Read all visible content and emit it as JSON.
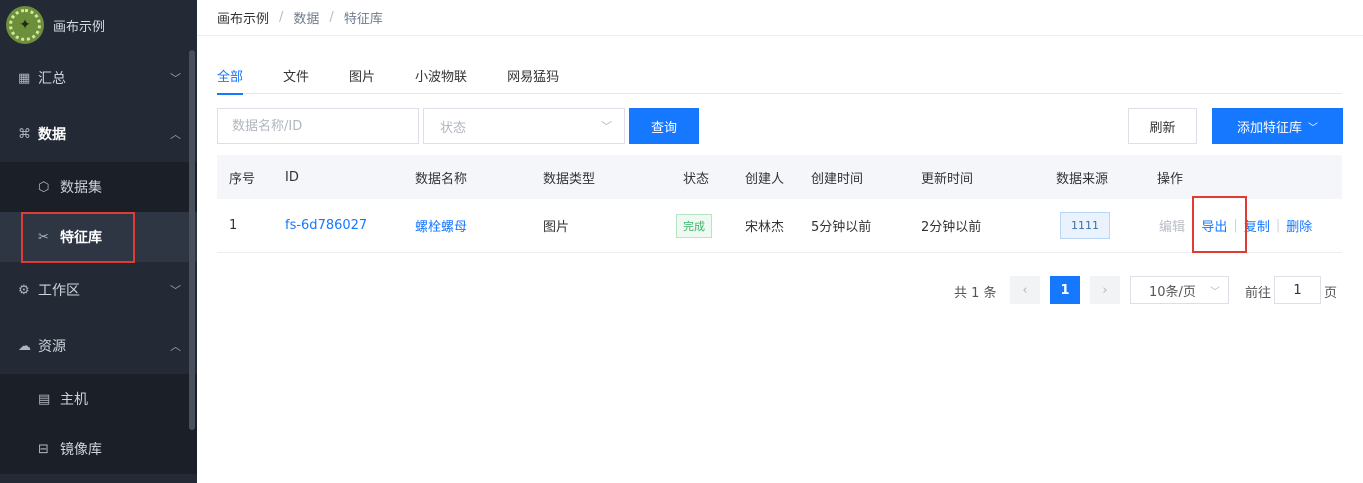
{
  "app": {
    "name": "画布示例"
  },
  "sidebar": {
    "groups": [
      {
        "label": "汇总",
        "icon": "grid-icon",
        "expanded": false
      },
      {
        "label": "数据",
        "icon": "hierarchy-icon",
        "expanded": true
      },
      {
        "label": "工作区",
        "icon": "gear-icon",
        "expanded": false
      },
      {
        "label": "资源",
        "icon": "cloud-icon",
        "expanded": true
      }
    ],
    "data_items": [
      {
        "label": "数据集",
        "icon": "cube-icon"
      },
      {
        "label": "特征库",
        "icon": "scissors-icon",
        "active": true
      }
    ],
    "resource_items": [
      {
        "label": "主机",
        "icon": "server-icon"
      },
      {
        "label": "镜像库",
        "icon": "storage-icon"
      }
    ]
  },
  "breadcrumb": [
    "画布示例",
    "数据",
    "特征库"
  ],
  "tabs": [
    "全部",
    "文件",
    "图片",
    "小波物联",
    "网易猛犸"
  ],
  "filters": {
    "search_placeholder": "数据名称/ID",
    "status_placeholder": "状态",
    "query_label": "查询",
    "refresh_label": "刷新",
    "add_label": "添加特征库"
  },
  "table": {
    "headers": [
      "序号",
      "ID",
      "数据名称",
      "数据类型",
      "状态",
      "创建人",
      "创建时间",
      "更新时间",
      "数据来源",
      "操作"
    ],
    "rows": [
      {
        "index": "1",
        "id": "fs-6d786027",
        "name": "螺栓螺母",
        "type": "图片",
        "status": "完成",
        "creator": "宋林杰",
        "created": "5分钟以前",
        "updated": "2分钟以前",
        "source": "1111",
        "ops": {
          "edit": "编辑",
          "export": "导出",
          "copy": "复制",
          "delete": "删除"
        }
      }
    ]
  },
  "pagination": {
    "total": "共 1 条",
    "current": "1",
    "page_size": "10条/页",
    "goto_prefix": "前往",
    "goto_value": "1",
    "goto_suffix": "页"
  },
  "colors": {
    "accent": "#1677ff",
    "sidebar_bg": "#242a35",
    "highlight": "#e03b35"
  }
}
